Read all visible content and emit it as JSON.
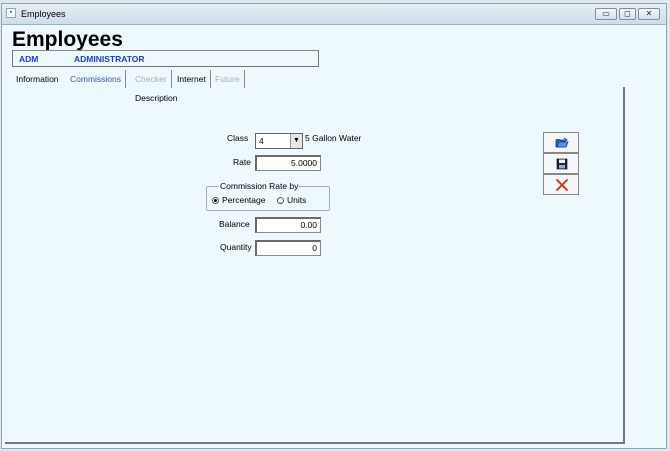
{
  "window": {
    "title": "Employees",
    "heading": "Employees"
  },
  "user": {
    "code": "ADM",
    "name": "ADMINISTRATOR"
  },
  "tabs": [
    {
      "label": "Information",
      "state": "normal"
    },
    {
      "label": "Commissions",
      "state": "active"
    },
    {
      "label": "Checker",
      "state": "disabled"
    },
    {
      "label": "Internet",
      "state": "normal"
    },
    {
      "label": "Future",
      "state": "disabled"
    }
  ],
  "form": {
    "description_label": "Description",
    "class_label": "Class",
    "class_value": "4",
    "class_description": "5 Gallon Water",
    "rate_label": "Rate",
    "rate_value": "5.0000",
    "commission_group_label": "Commission Rate by",
    "radio_percentage": "Percentage",
    "radio_units": "Units",
    "selected_basis": "Percentage",
    "balance_label": "Balance",
    "balance_value": "0.00",
    "quantity_label": "Quantity",
    "quantity_value": "0"
  },
  "actions": {
    "icons": [
      "open-folder-icon",
      "save-disk-icon",
      "delete-x-icon"
    ]
  },
  "colors": {
    "accent_blue": "#1f3bd8",
    "active_tab": "#3a4fd0",
    "disabled_tab": "#a7acb0",
    "delete_red": "#e0241c"
  }
}
